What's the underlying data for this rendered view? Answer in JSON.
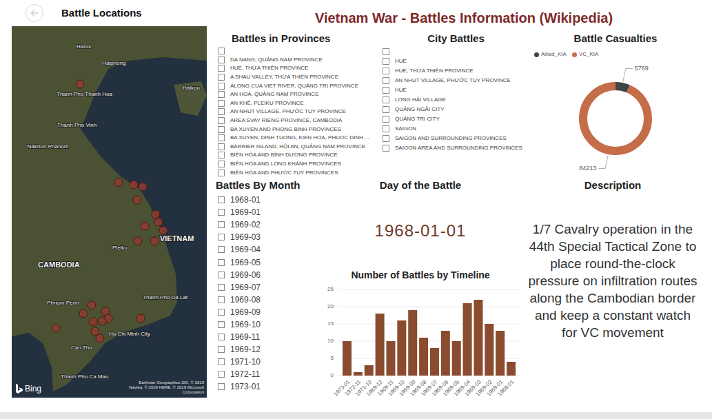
{
  "header": {
    "title": "Vietnam War - Battles Information (Wikipedia)"
  },
  "map": {
    "title": "Battle Locations",
    "labels": [
      {
        "text": "Hanoi",
        "lat": 21.03,
        "lon": 105.79,
        "kind": "city"
      },
      {
        "text": "Haiphong",
        "lat": 20.43,
        "lon": 106.96,
        "kind": "city"
      },
      {
        "text": "Thanh Pho Thanh Hoa",
        "lat": 19.31,
        "lon": 104.88,
        "kind": "city"
      },
      {
        "text": "Haikou",
        "lat": 19.53,
        "lon": 110.64,
        "kind": "city"
      },
      {
        "text": "Thanh Pho Vinh",
        "lat": 18.19,
        "lon": 104.91,
        "kind": "city"
      },
      {
        "text": "Nakhon Phanom",
        "lat": 17.41,
        "lon": 103.55,
        "kind": "city"
      },
      {
        "text": "Pleiku",
        "lat": 13.75,
        "lon": 107.43,
        "kind": "city"
      },
      {
        "text": "VIETNAM",
        "lat": 14.07,
        "lon": 109.6,
        "kind": "country"
      },
      {
        "text": "CAMBODIA",
        "lat": 13.12,
        "lon": 104.03,
        "kind": "country"
      },
      {
        "text": "Phnom Penh",
        "lat": 11.75,
        "lon": 104.44,
        "kind": "city"
      },
      {
        "text": "Thanh Pho Da Lat",
        "lat": 11.95,
        "lon": 108.82,
        "kind": "city"
      },
      {
        "text": "Ho Chi Minh City",
        "lat": 10.63,
        "lon": 107.27,
        "kind": "city"
      },
      {
        "text": "Can Tho",
        "lat": 10.13,
        "lon": 105.54,
        "kind": "city"
      },
      {
        "text": "Thanh Pho Ca Mau",
        "lat": 9.08,
        "lon": 105.07,
        "kind": "city"
      }
    ],
    "pins": [
      {
        "lat": 19.68,
        "lon": 105.95
      },
      {
        "lat": 16.12,
        "lon": 107.71
      },
      {
        "lat": 16.04,
        "lon": 108.41
      },
      {
        "lat": 15.97,
        "lon": 108.82
      },
      {
        "lat": 15.49,
        "lon": 108.56
      },
      {
        "lat": 14.97,
        "lon": 109.41
      },
      {
        "lat": 14.69,
        "lon": 109.54
      },
      {
        "lat": 14.54,
        "lon": 108.91
      },
      {
        "lat": 14.39,
        "lon": 109.76
      },
      {
        "lat": 14.0,
        "lon": 108.59
      },
      {
        "lat": 14.0,
        "lon": 109.35
      },
      {
        "lat": 11.68,
        "lon": 106.48
      },
      {
        "lat": 11.38,
        "lon": 106.11
      },
      {
        "lat": 11.45,
        "lon": 107.11
      },
      {
        "lat": 11.2,
        "lon": 107.24
      },
      {
        "lat": 11.08,
        "lon": 106.55
      },
      {
        "lat": 10.85,
        "lon": 104.85
      },
      {
        "lat": 10.73,
        "lon": 106.64
      },
      {
        "lat": 10.48,
        "lon": 106.86
      },
      {
        "lat": 11.2,
        "lon": 108.72
      },
      {
        "lat": 11.1,
        "lon": 106.96
      }
    ],
    "logo": "Bing",
    "attribution": [
      "Earthstar Geographics SIO, © 2019",
      "Navteq, © 2019 HERE, © 2019 Microsoft",
      "Corporation"
    ]
  },
  "provinces": {
    "title": "Battles in Provinces",
    "items": [
      {
        "label": "",
        "checked": false
      },
      {
        "label": "DA NANG, QUẢNG NAM PROVINCE",
        "checked": false
      },
      {
        "label": "HUẾ, THỪA THIÊN PROVINCE",
        "checked": false
      },
      {
        "label": "A SHAU VALLEY, THỪA THIÊN PROVINCE",
        "checked": false
      },
      {
        "label": "ALONG CUA VIET RIVER, QUẢNG TRỊ PROVINCE",
        "checked": false
      },
      {
        "label": "AN HOA, QUẢNG NAM PROVINCE",
        "checked": false
      },
      {
        "label": "AN KHÊ, PLEIKU PROVINCE",
        "checked": false
      },
      {
        "label": "AN NHUT VILLAGE, PHƯỚC TUY PROVINCE",
        "checked": false
      },
      {
        "label": "AREA SVAY RIENG PROVINCE, CAMBODIA",
        "checked": false
      },
      {
        "label": "BA XUYEN AND PHONG BINH PROVINCES",
        "checked": false
      },
      {
        "label": "BA XUYEN, DINH TUONG, KIEN HOA, PHUOC DINH ...",
        "checked": false
      },
      {
        "label": "BARRIER ISLAND, HỘI AN, QUẢNG NAM PROVINCE",
        "checked": false
      },
      {
        "label": "BIÊN HÒA AND BÌNH DƯƠNG PROVINCE",
        "checked": false
      },
      {
        "label": "BIÊN HÒA AND LONG KHÁNH PROVINCES",
        "checked": false
      },
      {
        "label": "BIÊN HÒA AND PHƯỚC TUY PROVINCES",
        "checked": false
      }
    ]
  },
  "cities": {
    "title": "City Battles",
    "items": [
      {
        "label": "",
        "checked": false
      },
      {
        "label": "HUẾ",
        "checked": false
      },
      {
        "label": "HUẾ, THỪA THIÊN PROVINCE",
        "checked": false
      },
      {
        "label": "AN NHUT VILLAGE, PHƯỚC TUY PROVINCE",
        "checked": false
      },
      {
        "label": "HUẾ",
        "checked": false
      },
      {
        "label": "LONG HẢI VILLAGE",
        "checked": false
      },
      {
        "label": "QUẢNG NGÃI CITY",
        "checked": false
      },
      {
        "label": "QUẢNG TRỊ CITY",
        "checked": false
      },
      {
        "label": "SAIGON",
        "checked": false
      },
      {
        "label": "SAIGON AND SURROUNDING PROVINCES",
        "checked": false
      },
      {
        "label": "SAIGON AREA AND SURROUNDING PROVINCES",
        "checked": false
      }
    ]
  },
  "casualties": {
    "title": "Battle Casualties",
    "series": [
      {
        "name": "Allied_KIA",
        "value": 5769,
        "label": "5769",
        "color": "#3f4545"
      },
      {
        "name": "VC_KIA",
        "value": 84213,
        "label": "84213",
        "color": "#c46d48"
      }
    ]
  },
  "months": {
    "title": "Battles By Month",
    "items": [
      {
        "label": "1968-01",
        "checked": false
      },
      {
        "label": "1969-01",
        "checked": false
      },
      {
        "label": "1969-02",
        "checked": false
      },
      {
        "label": "1969-03",
        "checked": false
      },
      {
        "label": "1969-04",
        "checked": false
      },
      {
        "label": "1969-05",
        "checked": false
      },
      {
        "label": "1969-06",
        "checked": false
      },
      {
        "label": "1969-07",
        "checked": false
      },
      {
        "label": "1969-08",
        "checked": false
      },
      {
        "label": "1969-09",
        "checked": false
      },
      {
        "label": "1969-10",
        "checked": false
      },
      {
        "label": "1969-11",
        "checked": false
      },
      {
        "label": "1969-12",
        "checked": false
      },
      {
        "label": "1971-10",
        "checked": false
      },
      {
        "label": "1972-11",
        "checked": false
      },
      {
        "label": "1973-01",
        "checked": false
      }
    ]
  },
  "day": {
    "title": "Day of the Battle",
    "value": "1968-01-01"
  },
  "chart": {
    "title": "Number of Battles by Timeline",
    "y_ticks": [
      "0",
      "5",
      "10",
      "15",
      "20",
      "25"
    ],
    "y_max": 25,
    "categories": [
      "1973-01",
      "1972-11",
      "1971-10",
      "1969-12",
      "1969-11",
      "1969-10",
      "1969-09",
      "1969-08",
      "1969-07",
      "1969-06",
      "1969-05",
      "1969-04",
      "1969-03",
      "1969-02",
      "1969-01",
      "1968-01"
    ],
    "values": [
      10,
      1,
      3,
      18,
      10,
      16,
      19,
      11,
      8,
      13,
      10,
      21,
      22,
      15,
      13,
      4
    ]
  },
  "description": {
    "title": "Description",
    "text": "1/7 Cavalry operation in the 44th Special Tactical Zone to place round-the-clock pressure on infiltration routes along the Cambodian border and keep a constant watch for VC movement"
  }
}
